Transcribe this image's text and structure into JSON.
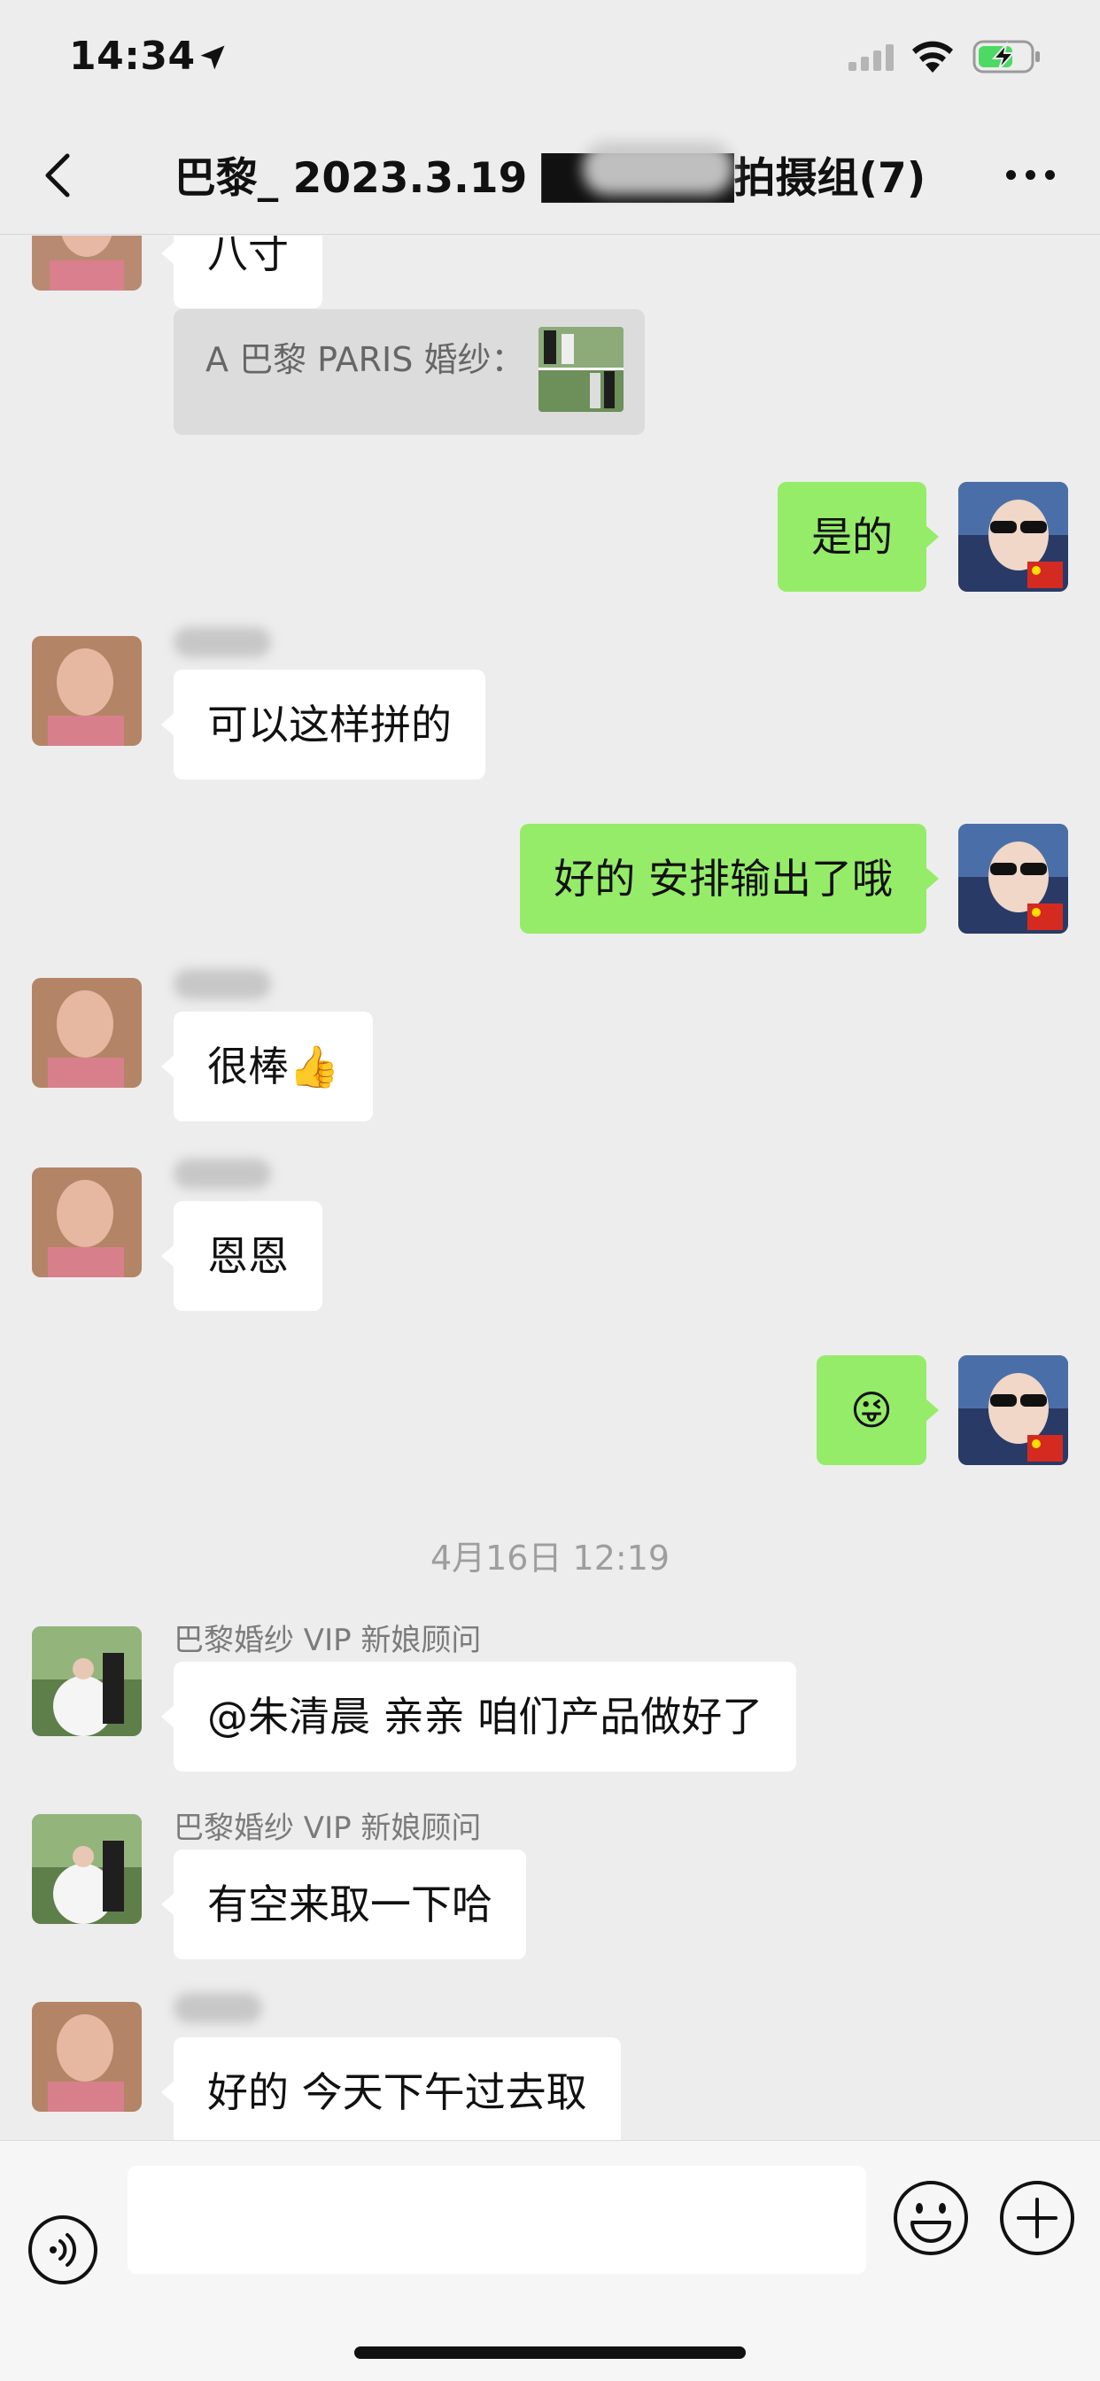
{
  "status_bar": {
    "time": "14:34"
  },
  "header": {
    "title": "巴黎_ 2023.3.19 ██████拍摄组(7)"
  },
  "quote": {
    "text": "A 巴黎 PARIS 婚纱："
  },
  "messages": {
    "m0": {
      "text": "八寸"
    },
    "m1": {
      "text": "是的"
    },
    "m2": {
      "text": "可以这样拼的"
    },
    "m3": {
      "text": "好的 安排输出了哦"
    },
    "m4": {
      "text": "很棒👍"
    },
    "m5": {
      "text": "恩恩"
    },
    "m6": {
      "text": "😜"
    },
    "m7": {
      "sender": "巴黎婚纱 VIP 新娘顾问",
      "text": "@朱清晨 亲亲 咱们产品做好了"
    },
    "m8": {
      "sender": "巴黎婚纱 VIP 新娘顾问",
      "text": "有空来取一下哈"
    },
    "m9": {
      "text": "好的 今天下午过去取"
    }
  },
  "timestamp": "4月16日 12:19",
  "input": {
    "placeholder": ""
  },
  "colors": {
    "background": "#ededed",
    "outgoing_bubble": "#95ec69",
    "incoming_bubble": "#ffffff"
  }
}
